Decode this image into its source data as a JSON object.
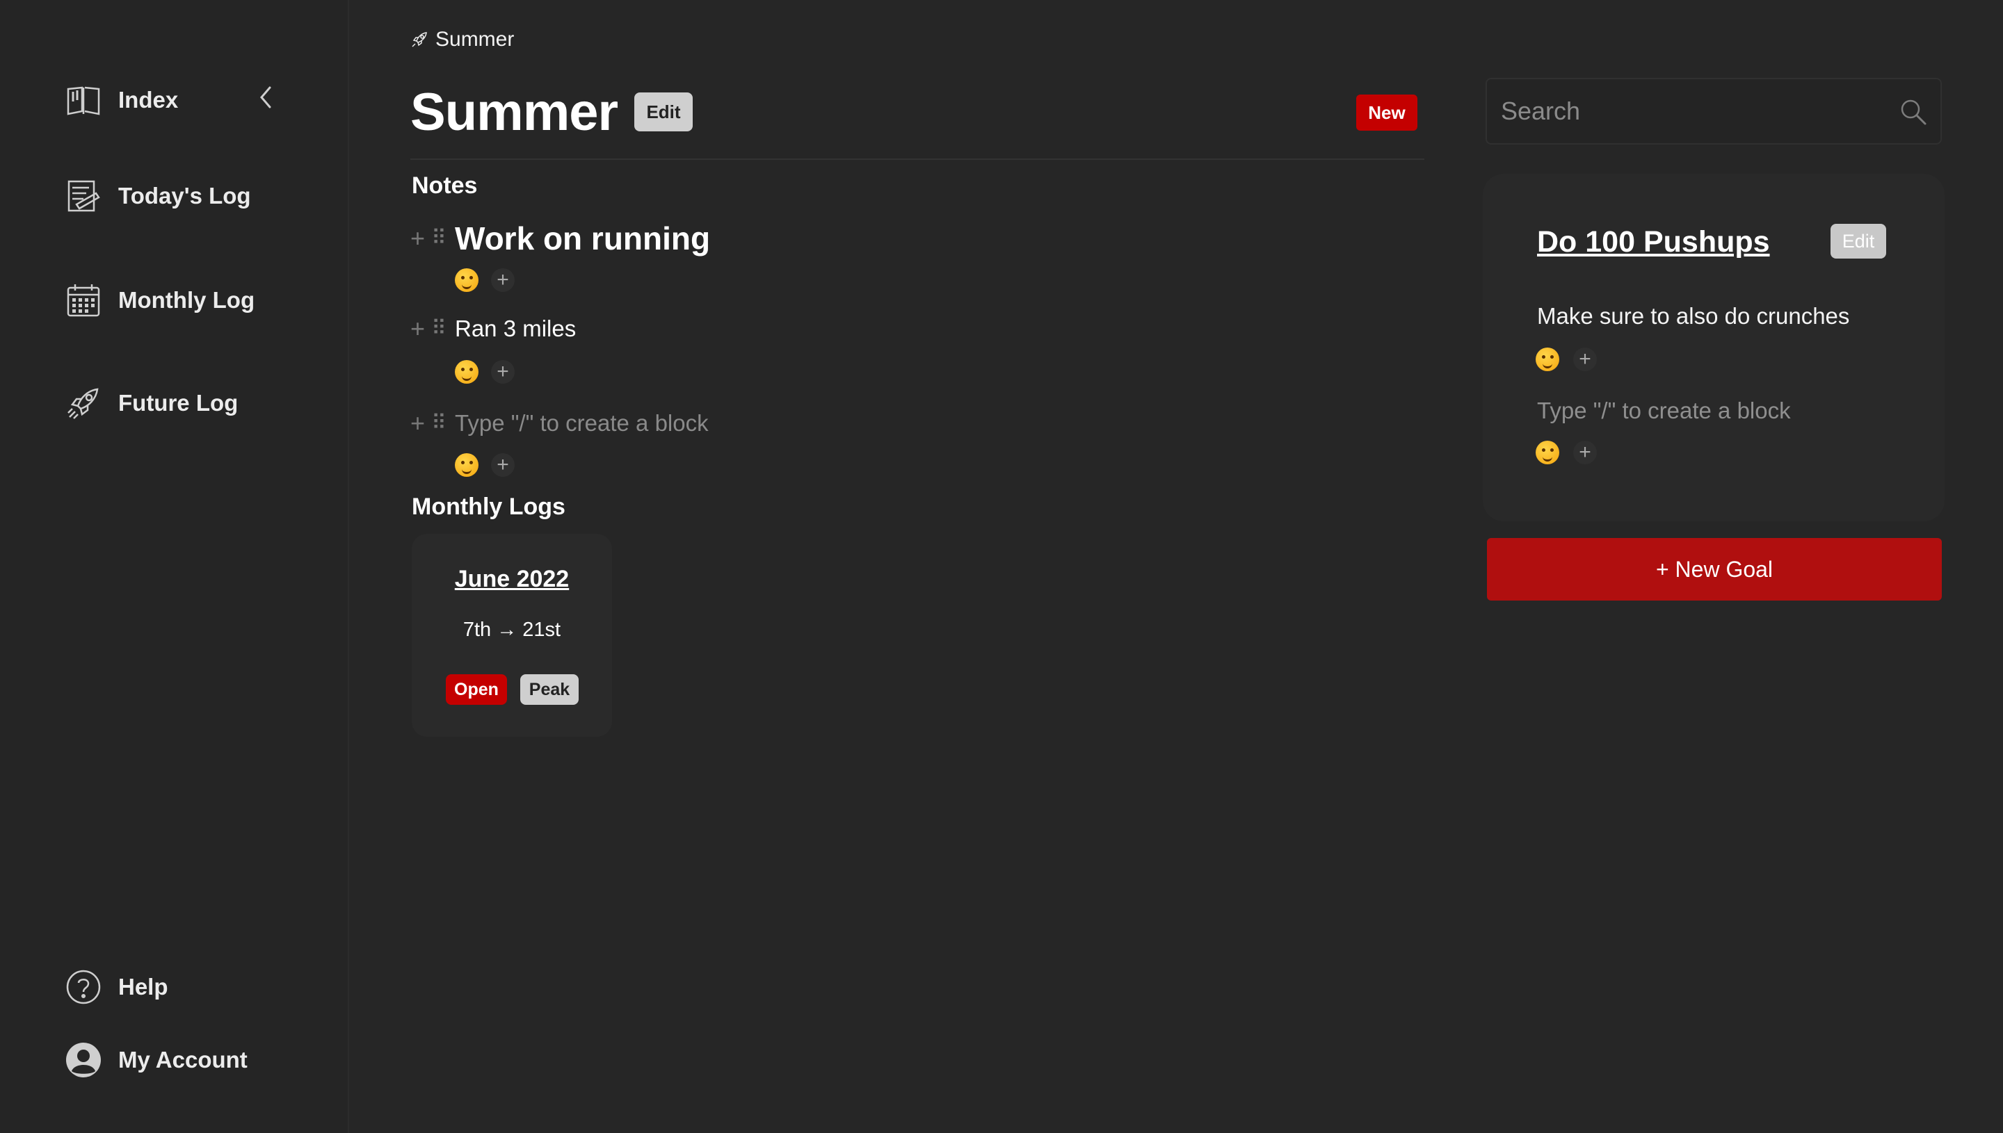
{
  "sidebar": {
    "items": [
      {
        "label": "Index",
        "icon": "book-icon"
      },
      {
        "label": "Today's Log",
        "icon": "notepad-icon"
      },
      {
        "label": "Monthly Log",
        "icon": "calendar-icon"
      },
      {
        "label": "Future Log",
        "icon": "rocket-icon"
      }
    ],
    "bottom": [
      {
        "label": "Help",
        "icon": "help-icon"
      },
      {
        "label": "My Account",
        "icon": "account-icon"
      }
    ]
  },
  "breadcrumb": {
    "icon": "rocket-icon",
    "label": "Summer"
  },
  "page": {
    "title": "Summer",
    "edit_label": "Edit",
    "new_label": "New"
  },
  "notes": {
    "heading": "Notes",
    "blocks": [
      {
        "text": "Work on running",
        "style": "heading"
      },
      {
        "text": "Ran 3 miles",
        "style": "text"
      }
    ],
    "placeholder": "Type \"/\" to create a block",
    "reaction_add": "+"
  },
  "monthly_logs": {
    "heading": "Monthly Logs",
    "cards": [
      {
        "title": "June 2022",
        "range": "7th → 21st",
        "open_label": "Open",
        "peak_label": "Peak"
      }
    ]
  },
  "search": {
    "placeholder": "Search"
  },
  "goal": {
    "title": "Do 100 Pushups",
    "edit_label": "Edit",
    "text": "Make sure to also do crunches",
    "placeholder": "Type \"/\" to create a block"
  },
  "new_goal_label": "+ New Goal",
  "colors": {
    "background": "#262626",
    "accent_red": "#c40000",
    "button_red": "#b00f0f"
  }
}
